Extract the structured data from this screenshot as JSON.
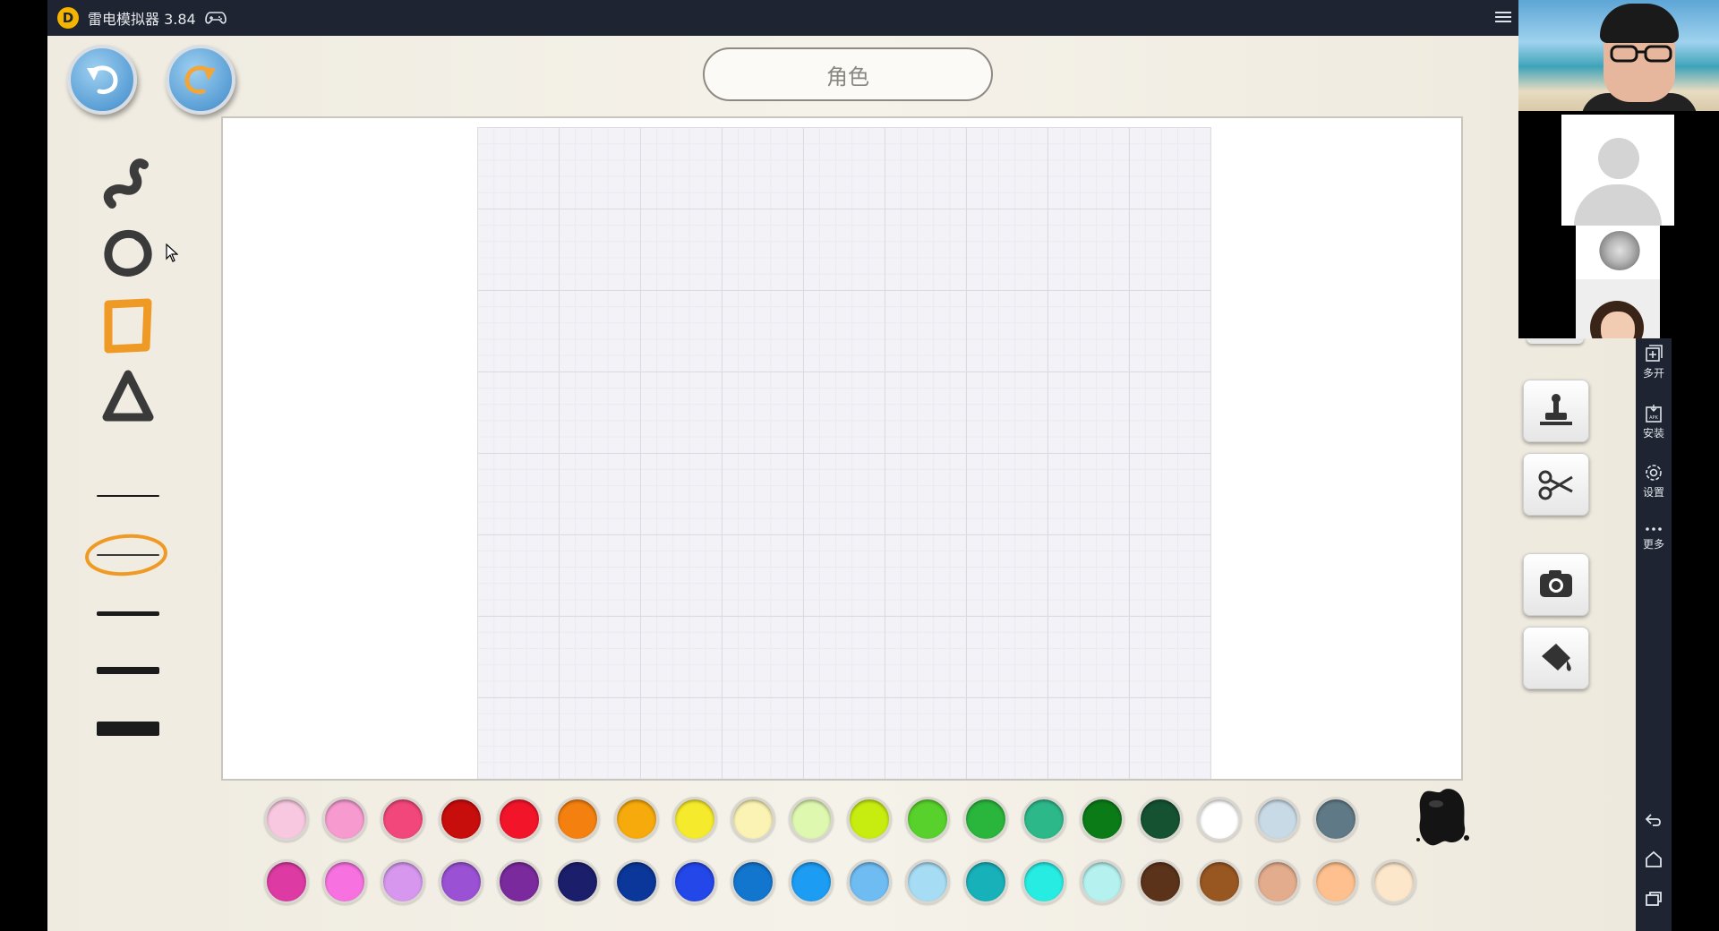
{
  "window": {
    "title": "雷电模拟器 3.84",
    "logo_glyph": "D",
    "logo_color": "#f5b400",
    "titlebar_color": "#1e2431"
  },
  "icons": {
    "undo": "undo-arrow-icon",
    "redo": "redo-arrow-icon",
    "menu": "hamburger-menu-icon",
    "gamepad": "gamepad-icon"
  },
  "app": {
    "title": "角色",
    "tools": [
      "freehand-brush",
      "circle",
      "rectangle",
      "triangle"
    ],
    "active_stroke_index": 1,
    "stroke_widths": [
      "thin",
      "light",
      "medium",
      "thick",
      "heavy"
    ]
  },
  "palette": {
    "row1": [
      "#f8c8e0",
      "#f79ad0",
      "#f2477a",
      "#c80d0d",
      "#f2152a",
      "#f4800f",
      "#f6aa0b",
      "#f6ea2c",
      "#faf3b4",
      "#def8b0",
      "#c7ec0f",
      "#58d12c",
      "#2ab53c",
      "#2db88a",
      "#0b7b17",
      "#145232",
      "#ffffff",
      "#c8dae6",
      "#5f7a86"
    ],
    "row2": [
      "#dd3aa3",
      "#f772e0",
      "#d797ef",
      "#9a51d3",
      "#7a2a9c",
      "#1b1e6b",
      "#0a3799",
      "#2347e8",
      "#1276cf",
      "#1c9cf2",
      "#6fbcf3",
      "#a7dcf5",
      "#17b1ba",
      "#27ece2",
      "#b4f1ef",
      "#5b321a",
      "#985721",
      "#e3ac8d",
      "#fdc08e",
      "#fde7cb"
    ],
    "ink_color": "#141414"
  },
  "side_tools": [
    "stamp-icon",
    "scissors-icon",
    "camera-icon",
    "paint-bucket-icon"
  ],
  "sidebar": {
    "items": [
      {
        "label": "多开",
        "icon": "multi-instance-icon"
      },
      {
        "label": "安装",
        "icon": "apk-install-icon"
      },
      {
        "label": "设置",
        "icon": "settings-gear-icon"
      },
      {
        "label": "更多",
        "icon": "more-dots-icon"
      }
    ],
    "bottom_icons": [
      "back-icon",
      "home-icon",
      "recents-icon"
    ]
  }
}
